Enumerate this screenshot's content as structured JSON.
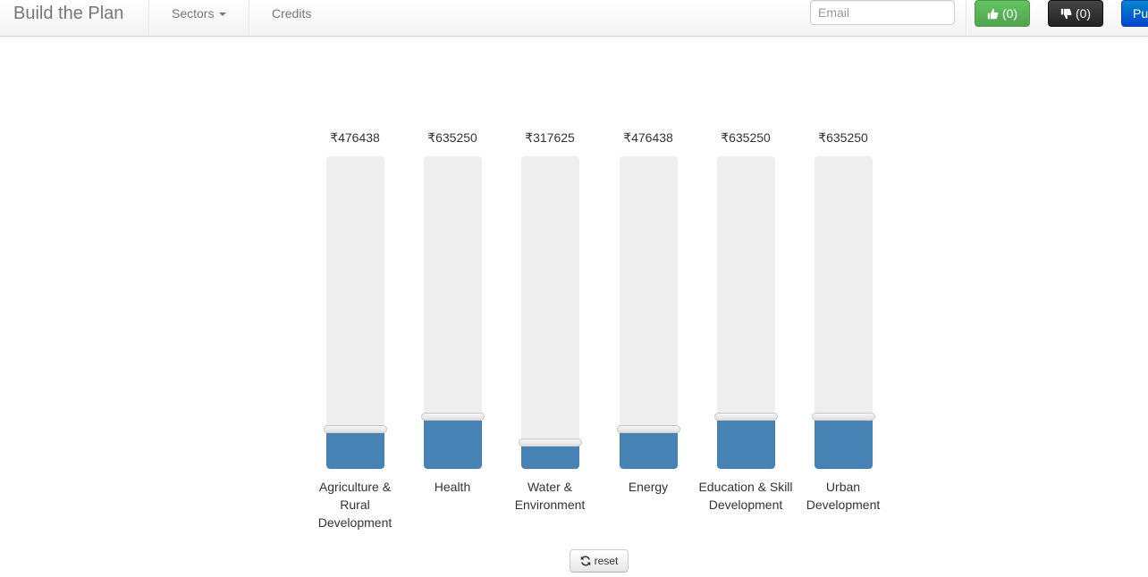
{
  "navbar": {
    "brand": "Build the Plan",
    "sectors_label": "Sectors",
    "credits_label": "Credits",
    "email_placeholder": "Email",
    "email_value": "",
    "like_count": "(0)",
    "dislike_count": "(0)",
    "publish_label": "Pu"
  },
  "icons": {
    "sectors_dropdown": "caret-down-icon",
    "like": "thumbs-up-icon",
    "dislike": "thumbs-down-icon",
    "reset": "refresh-icon"
  },
  "colors": {
    "fill": "#4682b4",
    "track": "#eeeeee",
    "like_button": "#5bb75b",
    "dislike_button": "#222222",
    "publish_button": "#0066cc"
  },
  "sectors": [
    {
      "amount": "₹476438",
      "label": "Agriculture & Rural Development",
      "level": 0.125
    },
    {
      "amount": "₹635250",
      "label": "Health",
      "level": 0.1667
    },
    {
      "amount": "₹317625",
      "label": "Water & Environment",
      "level": 0.0833
    },
    {
      "amount": "₹476438",
      "label": "Energy",
      "level": 0.125
    },
    {
      "amount": "₹635250",
      "label": "Education & Skill Development",
      "level": 0.1667
    },
    {
      "amount": "₹635250",
      "label": "Urban Development",
      "level": 0.1667
    }
  ],
  "reset_label": "reset"
}
